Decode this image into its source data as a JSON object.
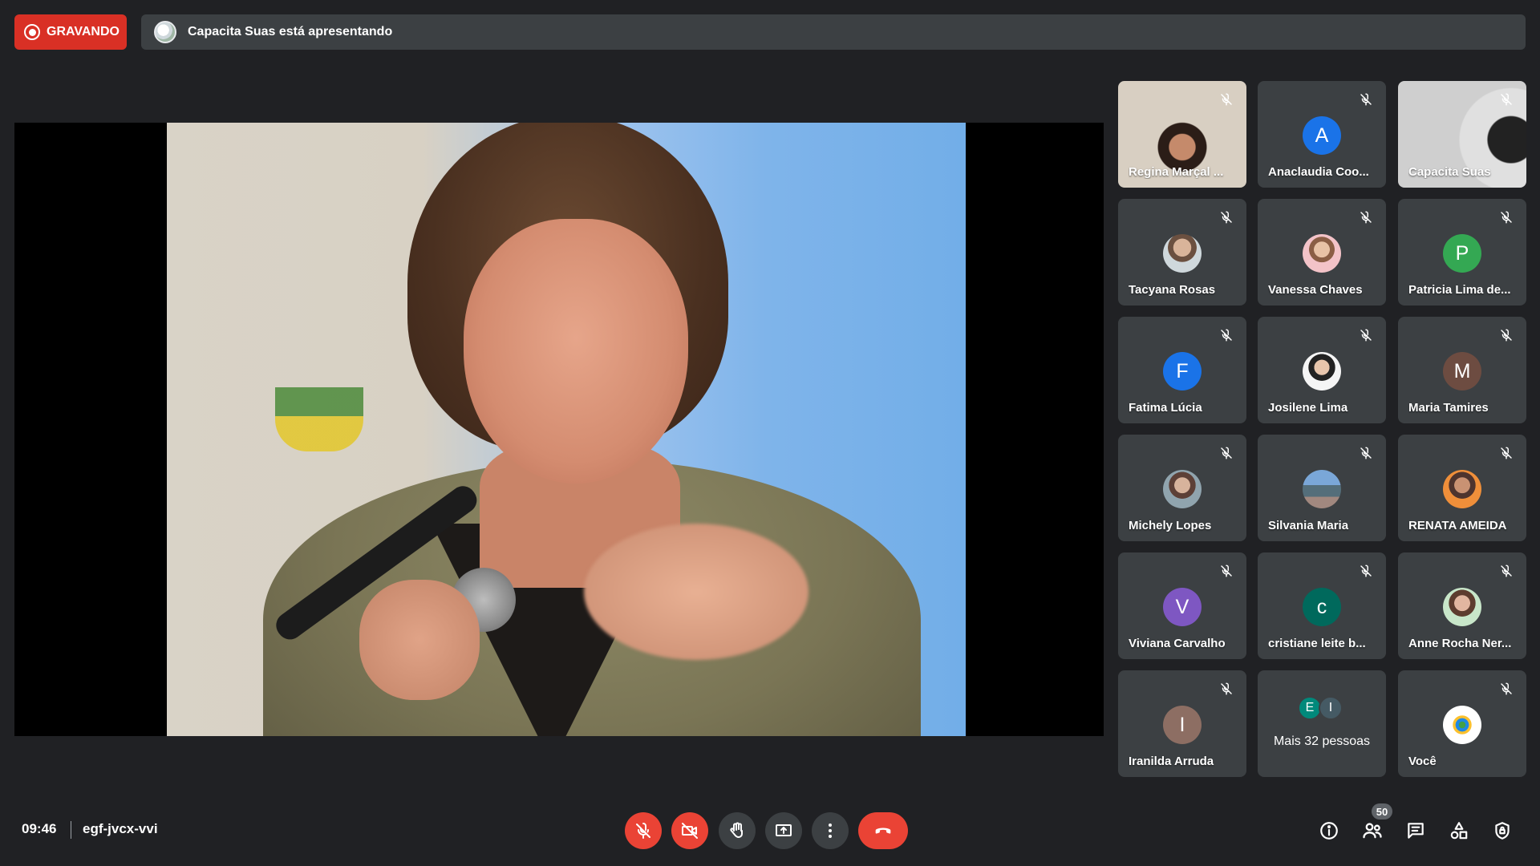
{
  "recording": {
    "label": "GRAVANDO",
    "color": "#d93025"
  },
  "presenting": {
    "text": "Capacita Suas está apresentando"
  },
  "participants": [
    {
      "name": "Regina Marçal ...",
      "kind": "camera"
    },
    {
      "name": "Anaclaudia Coo...",
      "kind": "letter",
      "initial": "A",
      "color": "#1a73e8"
    },
    {
      "name": "Capacita Suas",
      "kind": "camera"
    },
    {
      "name": "Tacyana Rosas",
      "kind": "photo"
    },
    {
      "name": "Vanessa Chaves",
      "kind": "photo"
    },
    {
      "name": "Patricia Lima de...",
      "kind": "letter",
      "initial": "P",
      "color": "#34a853"
    },
    {
      "name": "Fatima Lúcia",
      "kind": "letter",
      "initial": "F",
      "color": "#1a73e8"
    },
    {
      "name": "Josilene Lima",
      "kind": "photo"
    },
    {
      "name": "Maria Tamires",
      "kind": "letter",
      "initial": "M",
      "color": "#6d4c41"
    },
    {
      "name": "Michely Lopes",
      "kind": "photo"
    },
    {
      "name": "Silvania Maria",
      "kind": "photo"
    },
    {
      "name": "RENATA AMEIDA",
      "kind": "photo"
    },
    {
      "name": "Viviana Carvalho",
      "kind": "letter",
      "initial": "V",
      "color": "#7e57c2"
    },
    {
      "name": "cristiane leite b...",
      "kind": "letter",
      "initial": "c",
      "color": "#00695c"
    },
    {
      "name": "Anne Rocha Ner...",
      "kind": "photo"
    },
    {
      "name": "Iranilda Arruda",
      "kind": "letter",
      "initial": "I",
      "color": "#8d6e63"
    },
    {
      "name": "Você",
      "kind": "photo"
    }
  ],
  "more_people": {
    "label": "Mais 32 pessoas",
    "initials": [
      "E",
      "I"
    ],
    "colors": [
      "#00897b",
      "#455a64"
    ]
  },
  "footer": {
    "time": "09:46",
    "meeting_code": "egf-jvcx-vvi",
    "participant_count": "50"
  },
  "controls": [
    "mic-off-button",
    "camera-off-button",
    "raise-hand-button",
    "present-button",
    "more-options-button",
    "leave-call-button"
  ],
  "right_icons": [
    "info-icon",
    "people-icon",
    "chat-icon",
    "activities-icon",
    "host-controls-icon"
  ]
}
